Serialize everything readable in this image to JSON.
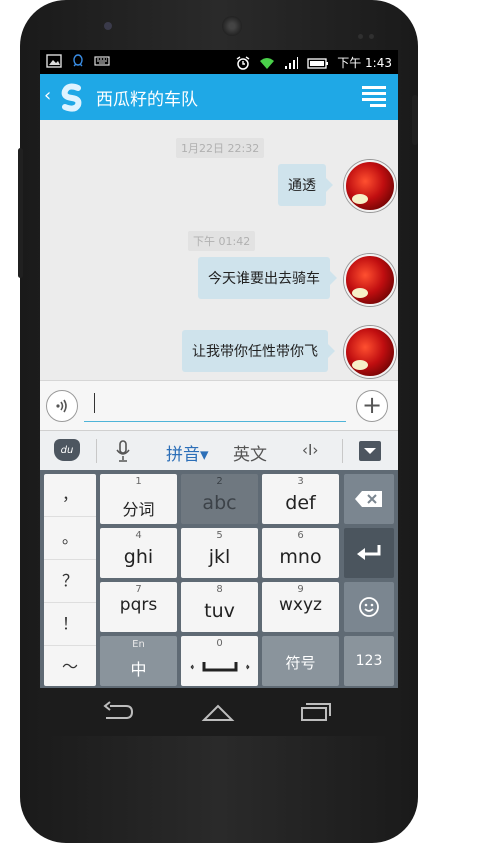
{
  "status_bar": {
    "time": "下午 1:43"
  },
  "title_bar": {
    "back": "‹",
    "title": "西瓜籽的车队",
    "logo": "S"
  },
  "chat": {
    "timestamps": [
      "1月22日 22:32",
      "下午 01:42"
    ],
    "messages": [
      "通透",
      "今天谁要出去骑车",
      "让我带你任性带你飞"
    ]
  },
  "input": {
    "voice_icon": "voice-icon",
    "placeholder": ""
  },
  "keyboard_toolbar": {
    "logo": "du",
    "mic": "mic-icon",
    "pinyin": "拼音▾",
    "english": "英文",
    "cursor": "‹I›",
    "hide": "keyboard-hide-icon"
  },
  "keyboard": {
    "punctuation": [
      "，",
      "。",
      "？",
      "！",
      "～"
    ],
    "keys": [
      {
        "num": "1",
        "label": "分词"
      },
      {
        "num": "2",
        "label": "abc"
      },
      {
        "num": "3",
        "label": "def"
      },
      {
        "num": "4",
        "label": "ghi"
      },
      {
        "num": "5",
        "label": "jkl"
      },
      {
        "num": "6",
        "label": "mno"
      },
      {
        "num": "7",
        "label": "pqrs"
      },
      {
        "num": "8",
        "label": "tuv"
      },
      {
        "num": "9",
        "label": "wxyz"
      }
    ],
    "en_label": "En",
    "zh_label": "中",
    "zero": "0",
    "symbol": "符号",
    "num123": "123"
  }
}
